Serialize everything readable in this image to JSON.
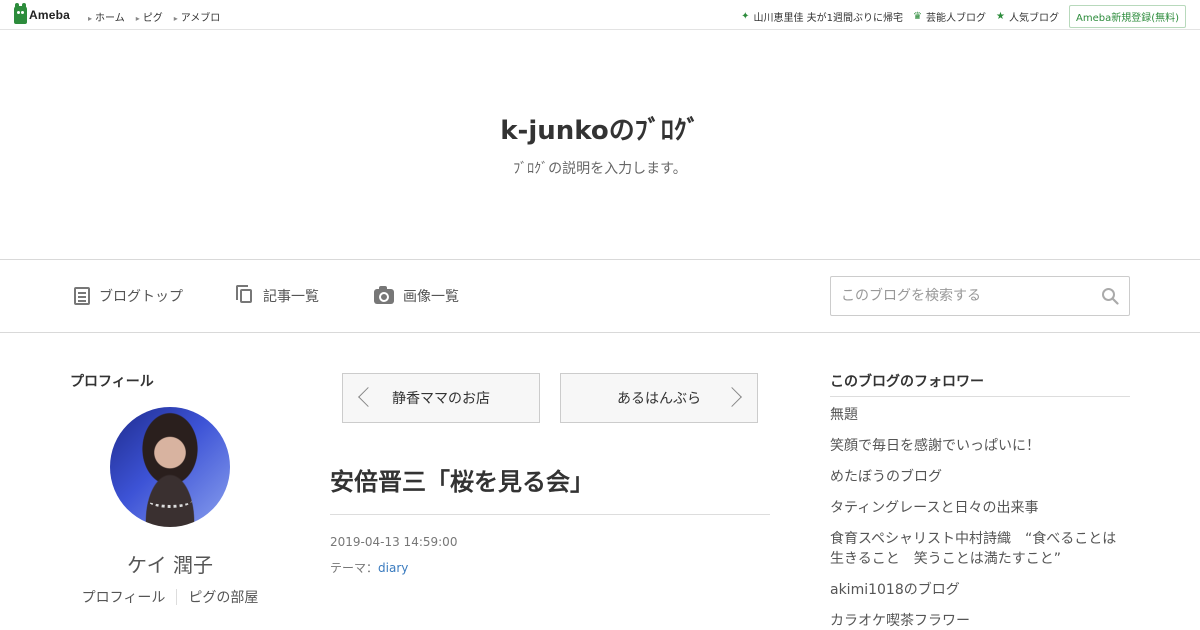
{
  "topbar": {
    "logo_text": "Ameba",
    "nav": [
      "ホーム",
      "ピグ",
      "アメブロ"
    ],
    "right_links": [
      {
        "icon": "sparkle-icon",
        "label": "山川恵里佳 夫が1週間ぶりに帰宅"
      },
      {
        "icon": "crown-icon",
        "label": "芸能人ブログ"
      },
      {
        "icon": "star-icon",
        "label": "人気ブログ"
      }
    ],
    "signup_label": "Ameba新規登録(無料)"
  },
  "header": {
    "title": "k-junkoのﾌﾞﾛｸﾞ",
    "description": "ﾌﾞﾛｸﾞの説明を入力します。"
  },
  "nav": {
    "blog_top": "ブログトップ",
    "entries": "記事一覧",
    "images": "画像一覧",
    "search_placeholder": "このブログを検索する"
  },
  "profile": {
    "heading": "プロフィール",
    "name": "ケイ 潤子",
    "links": [
      "プロフィール",
      "ピグの部屋"
    ]
  },
  "article": {
    "prev_label": "静香ママのお店",
    "next_label": "あるはんぶら",
    "title": "安倍晋三「桜を見る会」",
    "date": "2019-04-13 14:59:00",
    "theme_prefix": "テーマ：",
    "theme": "diary"
  },
  "followers": {
    "heading": "このブログのフォロワー",
    "items": [
      "無題",
      "笑顔で毎日を感謝でいっぱいに！",
      "めたぼうのブログ",
      "タティングレースと日々の出来事",
      "食育スペシャリスト中村詩織　“食べることは生きること　笑うことは満たすこと”",
      "akimi1018のブログ",
      "カラオケ喫茶フラワー"
    ]
  },
  "colors": {
    "brand": "#2d8c3c",
    "link": "#3a7bbf",
    "border": "#d9d9d9"
  }
}
